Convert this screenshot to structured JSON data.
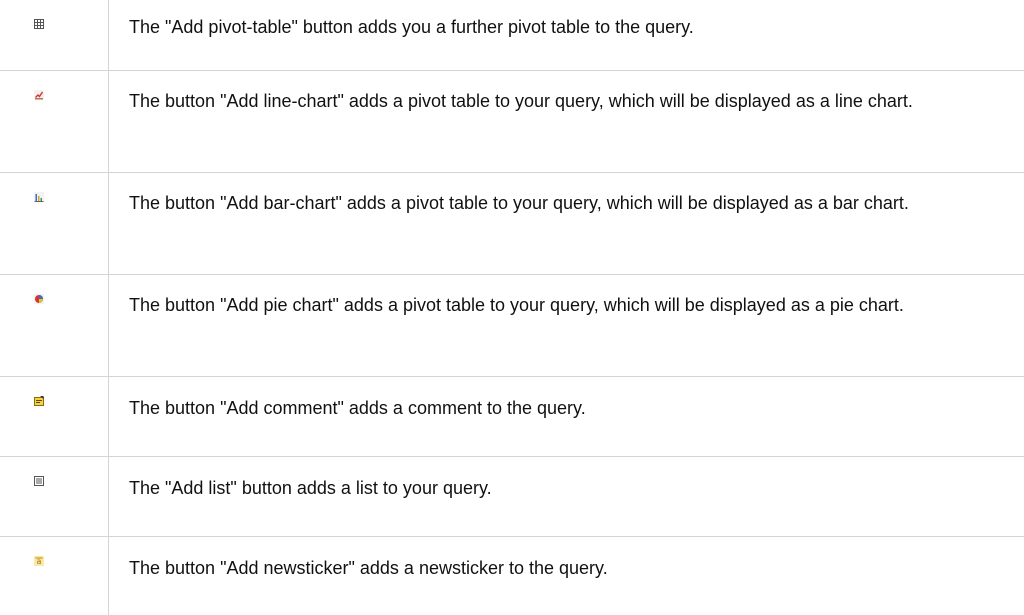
{
  "rows": [
    {
      "icon": "pivot-table-icon",
      "text": "The \"Add pivot-table\" button adds you a further pivot table to the query."
    },
    {
      "icon": "line-chart-icon",
      "text": "The button \"Add line-chart\" adds a pivot table to your query, which will be displayed as a line chart."
    },
    {
      "icon": "bar-chart-icon",
      "text": "The button \"Add bar-chart\" adds a pivot table to your query, which will be displayed as a bar chart."
    },
    {
      "icon": "pie-chart-icon",
      "text": "The button \"Add pie chart\" adds a pivot table to your query, which will be displayed as a pie chart."
    },
    {
      "icon": "comment-icon",
      "text": "The button \"Add comment\" adds a comment to the query."
    },
    {
      "icon": "list-icon",
      "text": "The \"Add list\" button adds a list to your query."
    },
    {
      "icon": "newsticker-icon",
      "text": "The button \"Add newsticker\" adds a newsticker to the query."
    }
  ]
}
